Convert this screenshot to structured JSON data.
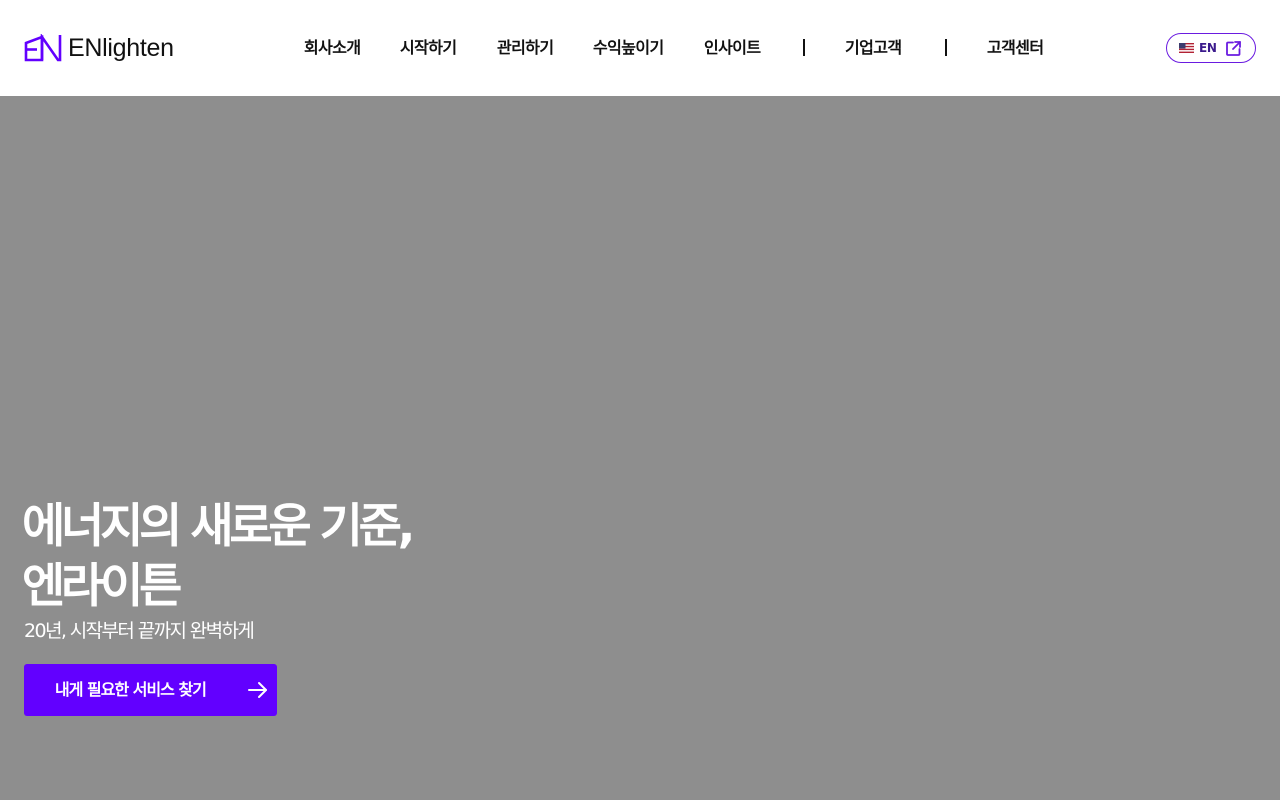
{
  "brand": {
    "name": "ENlighten",
    "logo_icon": "en-logo-mark",
    "accent_color": "#6200ff",
    "outline_color": "#6a1be0"
  },
  "nav": {
    "items": [
      {
        "label": "회사소개"
      },
      {
        "label": "시작하기"
      },
      {
        "label": "관리하기"
      },
      {
        "label": "수익높이기"
      },
      {
        "label": "인사이트"
      },
      {
        "label": "기업고객"
      },
      {
        "label": "고객센터"
      }
    ]
  },
  "language": {
    "label": "EN",
    "flag_icon": "us-flag-icon",
    "external_icon": "external-link-icon"
  },
  "hero": {
    "title_line1": "에너지의 새로운 기준,",
    "title_line2": "엔라이튼",
    "subtitle": "20년, 시작부터 끝까지 완벽하게",
    "cta_label": "내게 필요한 서비스 찾기",
    "cta_icon": "arrow-right-icon",
    "background_color": "#8e8e8e"
  }
}
